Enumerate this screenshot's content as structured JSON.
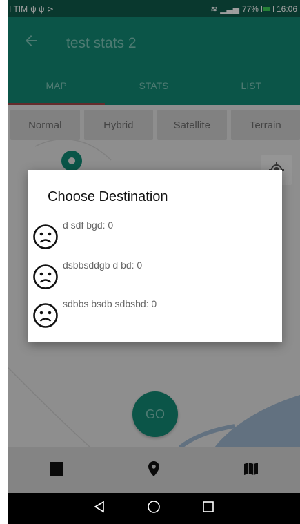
{
  "status_bar": {
    "carrier": "I TIM",
    "signal_pct": "77%",
    "time": "16:06"
  },
  "app_bar": {
    "title": "test stats 2"
  },
  "tabs": [
    {
      "label": "MAP"
    },
    {
      "label": "STATS"
    },
    {
      "label": "LIST"
    }
  ],
  "map_types": [
    {
      "label": "Normal"
    },
    {
      "label": "Hybrid"
    },
    {
      "label": "Satellite"
    },
    {
      "label": "Terrain"
    }
  ],
  "go_button": {
    "label": "GO"
  },
  "dialog": {
    "title": "Choose Destination",
    "items": [
      {
        "label": "d sdf bgd: 0"
      },
      {
        "label": "dsbbsddgb d bd: 0"
      },
      {
        "label": "sdbbs bsdb sdbsbd: 0"
      }
    ]
  },
  "icons": {
    "back": "arrow-left-icon",
    "locate": "my-location-icon",
    "bottom_nav": [
      "stop-square-icon",
      "place-pin-icon",
      "map-icon"
    ],
    "sys_nav": [
      "back-triangle-icon",
      "home-circle-icon",
      "recents-square-icon"
    ],
    "dest_face": "sad-face-icon"
  },
  "colors": {
    "primary": "#128a74",
    "primary_dark": "#0f5b4b",
    "tab_indicator": "#a24747"
  }
}
